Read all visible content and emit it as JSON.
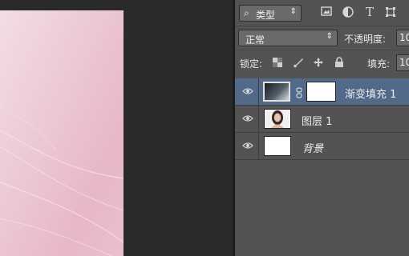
{
  "panel": {
    "filter": {
      "label": "类型",
      "arrow": "⇕"
    },
    "blend": {
      "mode": "正常",
      "arrow": "⇕",
      "opacity_label": "不透明度:",
      "opacity_value": "10"
    },
    "lock": {
      "label": "锁定:",
      "fill_label": "填充:",
      "fill_value": "10"
    },
    "layers": [
      {
        "name": "渐变填充 1",
        "active": true
      },
      {
        "name": "图层 1",
        "active": false
      },
      {
        "name": "背景",
        "active": false
      }
    ]
  }
}
